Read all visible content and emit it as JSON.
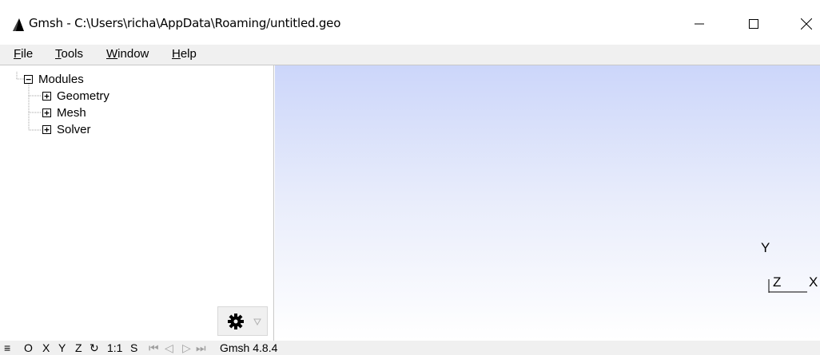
{
  "window": {
    "title": "Gmsh - C:\\Users\\richa\\AppData\\Roaming/untitled.geo",
    "controls": {
      "minimize": "—",
      "maximize": "☐",
      "close": "✕"
    }
  },
  "menu": {
    "file": {
      "accel": "F",
      "rest": "ile"
    },
    "tools": {
      "accel": "T",
      "rest": "ools"
    },
    "window": {
      "accel": "W",
      "rest": "indow"
    },
    "help": {
      "accel": "H",
      "rest": "elp"
    }
  },
  "tree": {
    "root": {
      "label": "Modules",
      "toggle": "−"
    },
    "children": [
      {
        "label": "Geometry",
        "toggle": "+"
      },
      {
        "label": "Mesh",
        "toggle": "+"
      },
      {
        "label": "Solver",
        "toggle": "+"
      }
    ]
  },
  "graphics": {
    "axes": {
      "y": "Y",
      "z": "Z",
      "x": "X"
    },
    "background_top": "#ccd6fa",
    "background_bottom": "#ffffff"
  },
  "statusbar": {
    "menu": "≡",
    "o": "O",
    "x": "X",
    "y": "Y",
    "z": "Z",
    "rotate": "↻",
    "scale": "1:1",
    "s": "S",
    "first": "⏮",
    "prev": "◁",
    "play": "▷",
    "next": "⏭",
    "version": "Gmsh 4.8.4"
  },
  "icons": {
    "app": "gmsh-logo-icon",
    "gear": "gear-icon",
    "dropdown": "triangle-down-icon"
  }
}
